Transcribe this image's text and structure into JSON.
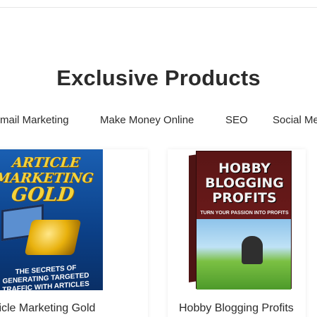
{
  "section": {
    "title": "Exclusive Products"
  },
  "tabs": [
    {
      "label": "Email Marketing"
    },
    {
      "label": "Make Money Online"
    },
    {
      "label": "SEO"
    },
    {
      "label": "Social Media"
    }
  ],
  "products": [
    {
      "title": "Article Marketing Gold",
      "cover": {
        "line1": "ARTICLE MARKETING",
        "line2": "GOLD",
        "tagline": "THE SECRETS OF GENERATING TARGETED TRAFFIC WITH ARTICLES"
      }
    },
    {
      "title": "Hobby Blogging Profits",
      "cover": {
        "title": "HOBBY BLOGGING PROFITS",
        "subtitle": "TURN YOUR PASSION INTO PROFITS"
      }
    }
  ],
  "colors": {
    "title": "#2b2b2b",
    "cover1_bg": "#0b3f86",
    "cover1_gold": "#f4d33b",
    "cover2_bg": "#5a1616"
  }
}
